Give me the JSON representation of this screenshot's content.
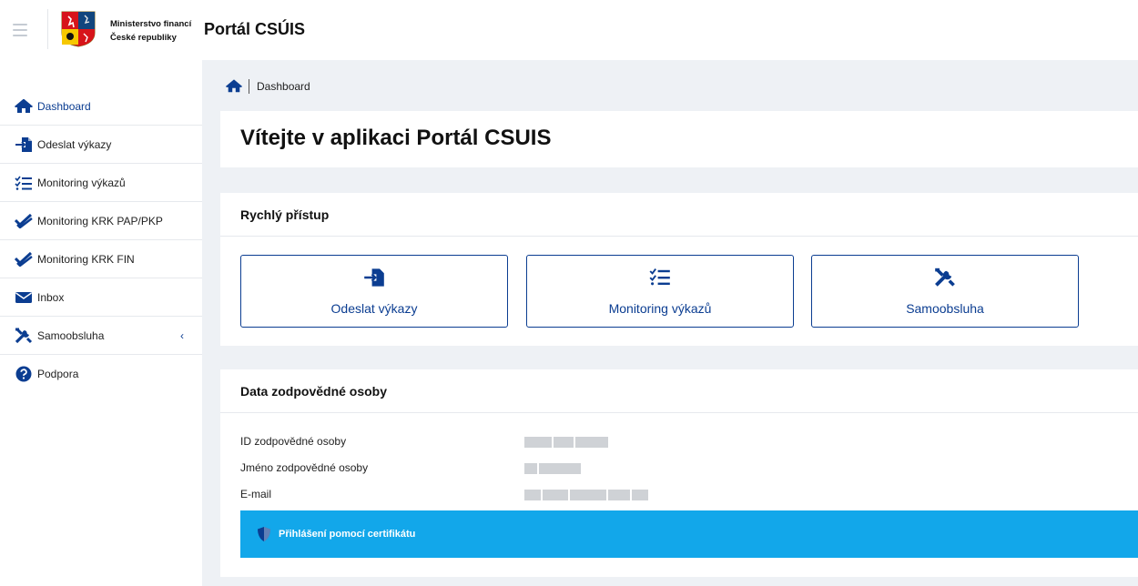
{
  "header": {
    "ministry_line1": "Ministerstvo financí",
    "ministry_line2": "České republiky",
    "app_title": "Portál CSÚIS"
  },
  "sidebar": {
    "items": [
      {
        "label": "Dashboard",
        "icon": "home-icon",
        "active": true
      },
      {
        "label": "Odeslat výkazy",
        "icon": "file-import-icon"
      },
      {
        "label": "Monitoring výkazů",
        "icon": "checklist-icon"
      },
      {
        "label": "Monitoring KRK PAP/PKP",
        "icon": "double-check-icon"
      },
      {
        "label": "Monitoring KRK FIN",
        "icon": "double-check-icon"
      },
      {
        "label": "Inbox",
        "icon": "envelope-icon"
      },
      {
        "label": "Samoobsluha",
        "icon": "tools-icon",
        "chevron": "‹"
      },
      {
        "label": "Podpora",
        "icon": "question-circle-icon"
      }
    ]
  },
  "breadcrumb": {
    "current": "Dashboard"
  },
  "welcome": {
    "title": "Vítejte v aplikaci Portál CSUIS"
  },
  "quick_access": {
    "title": "Rychlý přístup",
    "buttons": [
      {
        "label": "Odeslat výkazy",
        "icon": "file-import-icon"
      },
      {
        "label": "Monitoring výkazů",
        "icon": "checklist-icon"
      },
      {
        "label": "Samoobsluha",
        "icon": "tools-icon"
      }
    ]
  },
  "responsible_person": {
    "title": "Data zodpovědné osoby",
    "rows": [
      {
        "label": "ID zodpovědné osoby",
        "value": "(redacted)"
      },
      {
        "label": "Jméno zodpovědné osoby",
        "value": "(redacted)"
      },
      {
        "label": "E-mail",
        "value": "(redacted)"
      }
    ],
    "cert_label": "Přihlášení pomocí certifikátu"
  },
  "colors": {
    "primary": "#0b3d91",
    "main_bg": "#eef1f5",
    "cert_bar": "#12a7ea"
  }
}
